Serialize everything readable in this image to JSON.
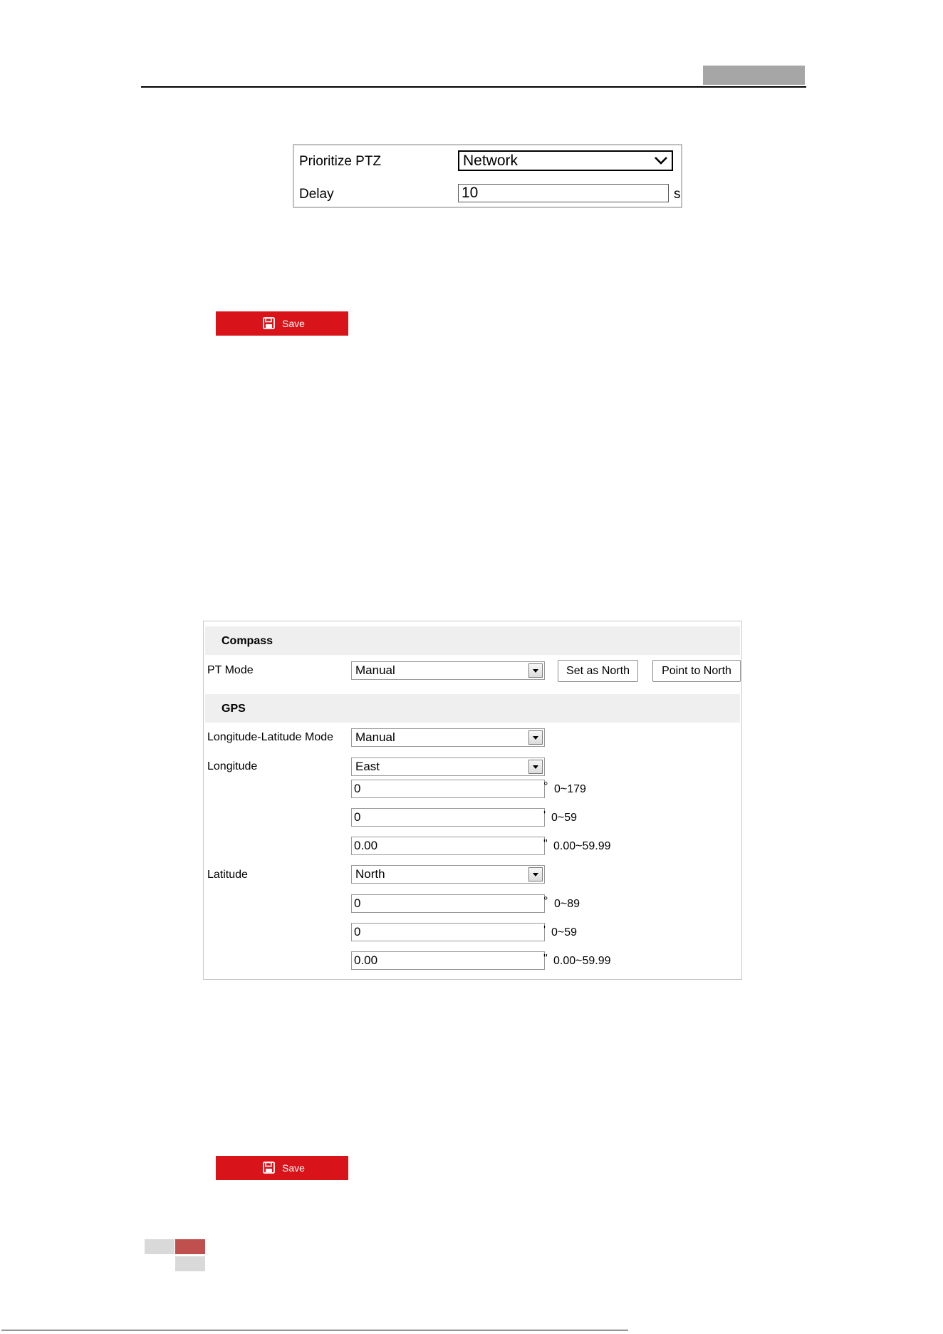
{
  "ptz_panel": {
    "prioritize_label": "Prioritize PTZ",
    "prioritize_value": "Network",
    "delay_label": "Delay",
    "delay_value": "10",
    "delay_unit": "s"
  },
  "save_button_label": "Save",
  "compass": {
    "section_title": "Compass",
    "pt_mode_label": "PT Mode",
    "pt_mode_value": "Manual",
    "set_as_north_label": "Set as North",
    "point_to_north_label": "Point to North"
  },
  "gps": {
    "section_title": "GPS",
    "mode_label": "Longitude-Latitude Mode",
    "mode_value": "Manual",
    "longitude": {
      "label": "Longitude",
      "direction": "East",
      "degrees": "0",
      "degrees_unit": "°",
      "degrees_range": "0~179",
      "minutes": "0",
      "minutes_unit": "'",
      "minutes_range": "0~59",
      "seconds": "0.00",
      "seconds_unit": "\"",
      "seconds_range": "0.00~59.99"
    },
    "latitude": {
      "label": "Latitude",
      "direction": "North",
      "degrees": "0",
      "degrees_unit": "°",
      "degrees_range": "0~89",
      "minutes": "0",
      "minutes_unit": "'",
      "minutes_range": "0~59",
      "seconds": "0.00",
      "seconds_unit": "\"",
      "seconds_range": "0.00~59.99"
    }
  },
  "colors": {
    "save_button": "#d8141a",
    "footer_accent": "#c0504d",
    "footer_gray": "#d9d9d9",
    "header_tab": "#a6a6a6"
  },
  "icons": [
    "chevron-down-icon",
    "save-icon",
    "dropdown-arrow-icon"
  ]
}
